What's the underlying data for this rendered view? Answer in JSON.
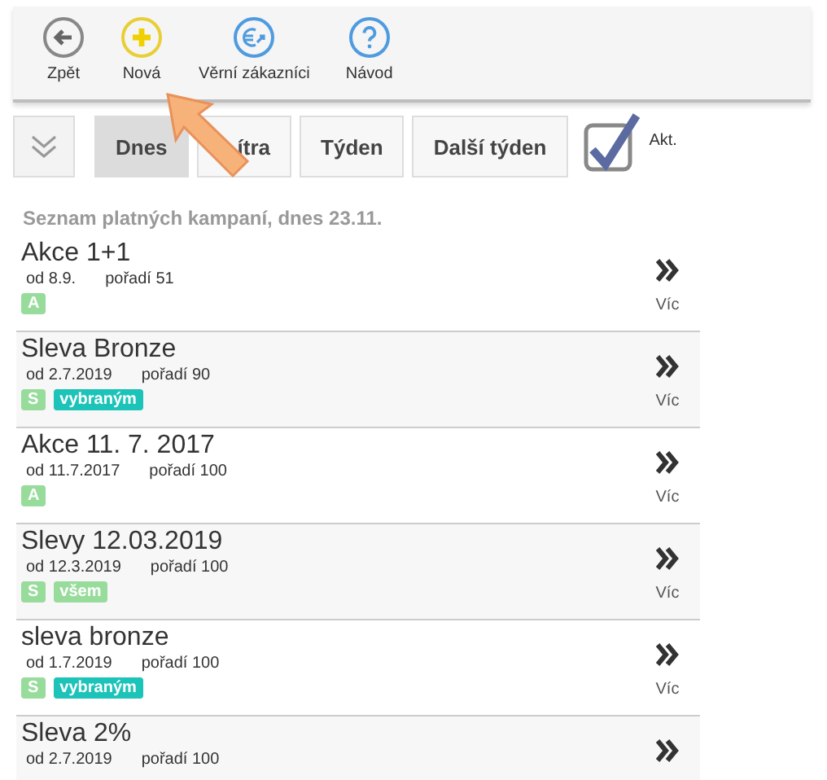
{
  "toolbar": [
    {
      "kind": "back",
      "label": "Zpět"
    },
    {
      "kind": "new",
      "label": "Nová"
    },
    {
      "kind": "loyal",
      "label": "Věrní zákazníci"
    },
    {
      "kind": "help",
      "label": "Návod"
    }
  ],
  "filters": {
    "tabs": [
      {
        "label": "Dnes",
        "selected": true
      },
      {
        "label": "ítra",
        "selected": false
      },
      {
        "label": "Týden",
        "selected": false
      },
      {
        "label": "Další týden",
        "selected": false
      }
    ],
    "active": {
      "label": "Akt.",
      "checked": true
    }
  },
  "list_title": "Seznam platných kampaní, dnes 23.11.",
  "campaigns": [
    {
      "name": "Akce 1+1",
      "from": "od 8.9.",
      "order": "pořadí 51",
      "badges": [
        {
          "text": "A",
          "color": "#98dc9c"
        }
      ],
      "more": "Víc"
    },
    {
      "name": "Sleva Bronze",
      "from": "od 2.7.2019",
      "order": "pořadí 90",
      "badges": [
        {
          "text": "S",
          "color": "#98dc9c"
        },
        {
          "text": "vybraným",
          "color": "#1cc3b8"
        }
      ],
      "more": "Víc"
    },
    {
      "name": "Akce 11. 7. 2017",
      "from": "od 11.7.2017",
      "order": "pořadí 100",
      "badges": [
        {
          "text": "A",
          "color": "#98dc9c"
        }
      ],
      "more": "Víc"
    },
    {
      "name": "Slevy 12.03.2019",
      "from": "od 12.3.2019",
      "order": "pořadí 100",
      "badges": [
        {
          "text": "S",
          "color": "#98dc9c"
        },
        {
          "text": "všem",
          "color": "#98dc9c"
        }
      ],
      "more": "Víc"
    },
    {
      "name": "sleva bronze",
      "from": "od 1.7.2019",
      "order": "pořadí 100",
      "badges": [
        {
          "text": "S",
          "color": "#98dc9c"
        },
        {
          "text": "vybraným",
          "color": "#1cc3b8"
        }
      ],
      "more": "Víc"
    },
    {
      "name": "Sleva 2%",
      "from": "od 2.7.2019",
      "order": "pořadí 100"
    }
  ]
}
